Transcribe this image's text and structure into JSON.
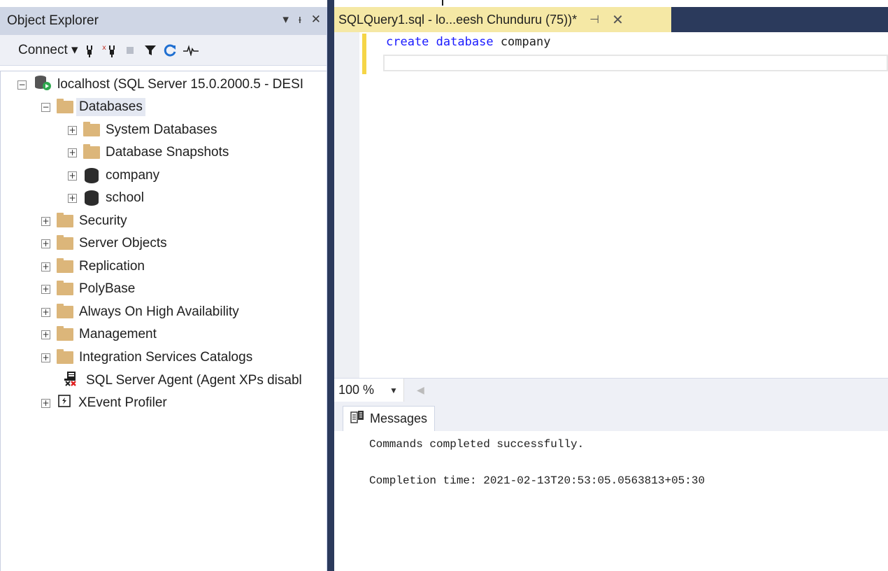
{
  "object_explorer": {
    "title": "Object Explorer",
    "title_controls": [
      "▾",
      "ᵻ",
      "✕"
    ],
    "toolbar": {
      "connect_label": "Connect ▾"
    },
    "tree": [
      {
        "label": "localhost (SQL Server 15.0.2000.5 - DESI",
        "expander": "−",
        "icon": "server-icon"
      },
      {
        "label": "Databases",
        "expander": "−",
        "icon": "folder-icon"
      },
      {
        "label": "System Databases",
        "expander": "+",
        "icon": "folder-icon"
      },
      {
        "label": "Database Snapshots",
        "expander": "+",
        "icon": "folder-icon"
      },
      {
        "label": "company",
        "expander": "+",
        "icon": "database-icon"
      },
      {
        "label": "school",
        "expander": "+",
        "icon": "database-icon"
      },
      {
        "label": "Security",
        "expander": "+",
        "icon": "folder-icon"
      },
      {
        "label": "Server Objects",
        "expander": "+",
        "icon": "folder-icon"
      },
      {
        "label": "Replication",
        "expander": "+",
        "icon": "folder-icon"
      },
      {
        "label": "PolyBase",
        "expander": "+",
        "icon": "folder-icon"
      },
      {
        "label": "Always On High Availability",
        "expander": "+",
        "icon": "folder-icon"
      },
      {
        "label": "Management",
        "expander": "+",
        "icon": "folder-icon"
      },
      {
        "label": "Integration Services Catalogs",
        "expander": "+",
        "icon": "folder-icon"
      },
      {
        "label": "SQL Server Agent (Agent XPs disabl",
        "expander": "",
        "icon": "agent-disabled-icon"
      },
      {
        "label": "XEvent Profiler",
        "expander": "+",
        "icon": "xevent-icon"
      }
    ]
  },
  "editor": {
    "tab_title": "SQLQuery1.sql - lo...eesh Chunduru (75))*",
    "tab_pin": "⊣",
    "tab_close": "✕",
    "code": {
      "kw1": "create",
      "kw2": "database",
      "name": "company"
    },
    "zoom": "100 %"
  },
  "results": {
    "tab_label": "Messages",
    "lines": [
      "Commands completed successfully.",
      "",
      "Completion time: 2021-02-13T20:53:05.0563813+05:30"
    ]
  },
  "colors": {
    "accent_tab": "#f5e8a5",
    "chrome_dark": "#2b3a5c",
    "keyword": "#1a1aff",
    "folder": "#dcb67a"
  }
}
